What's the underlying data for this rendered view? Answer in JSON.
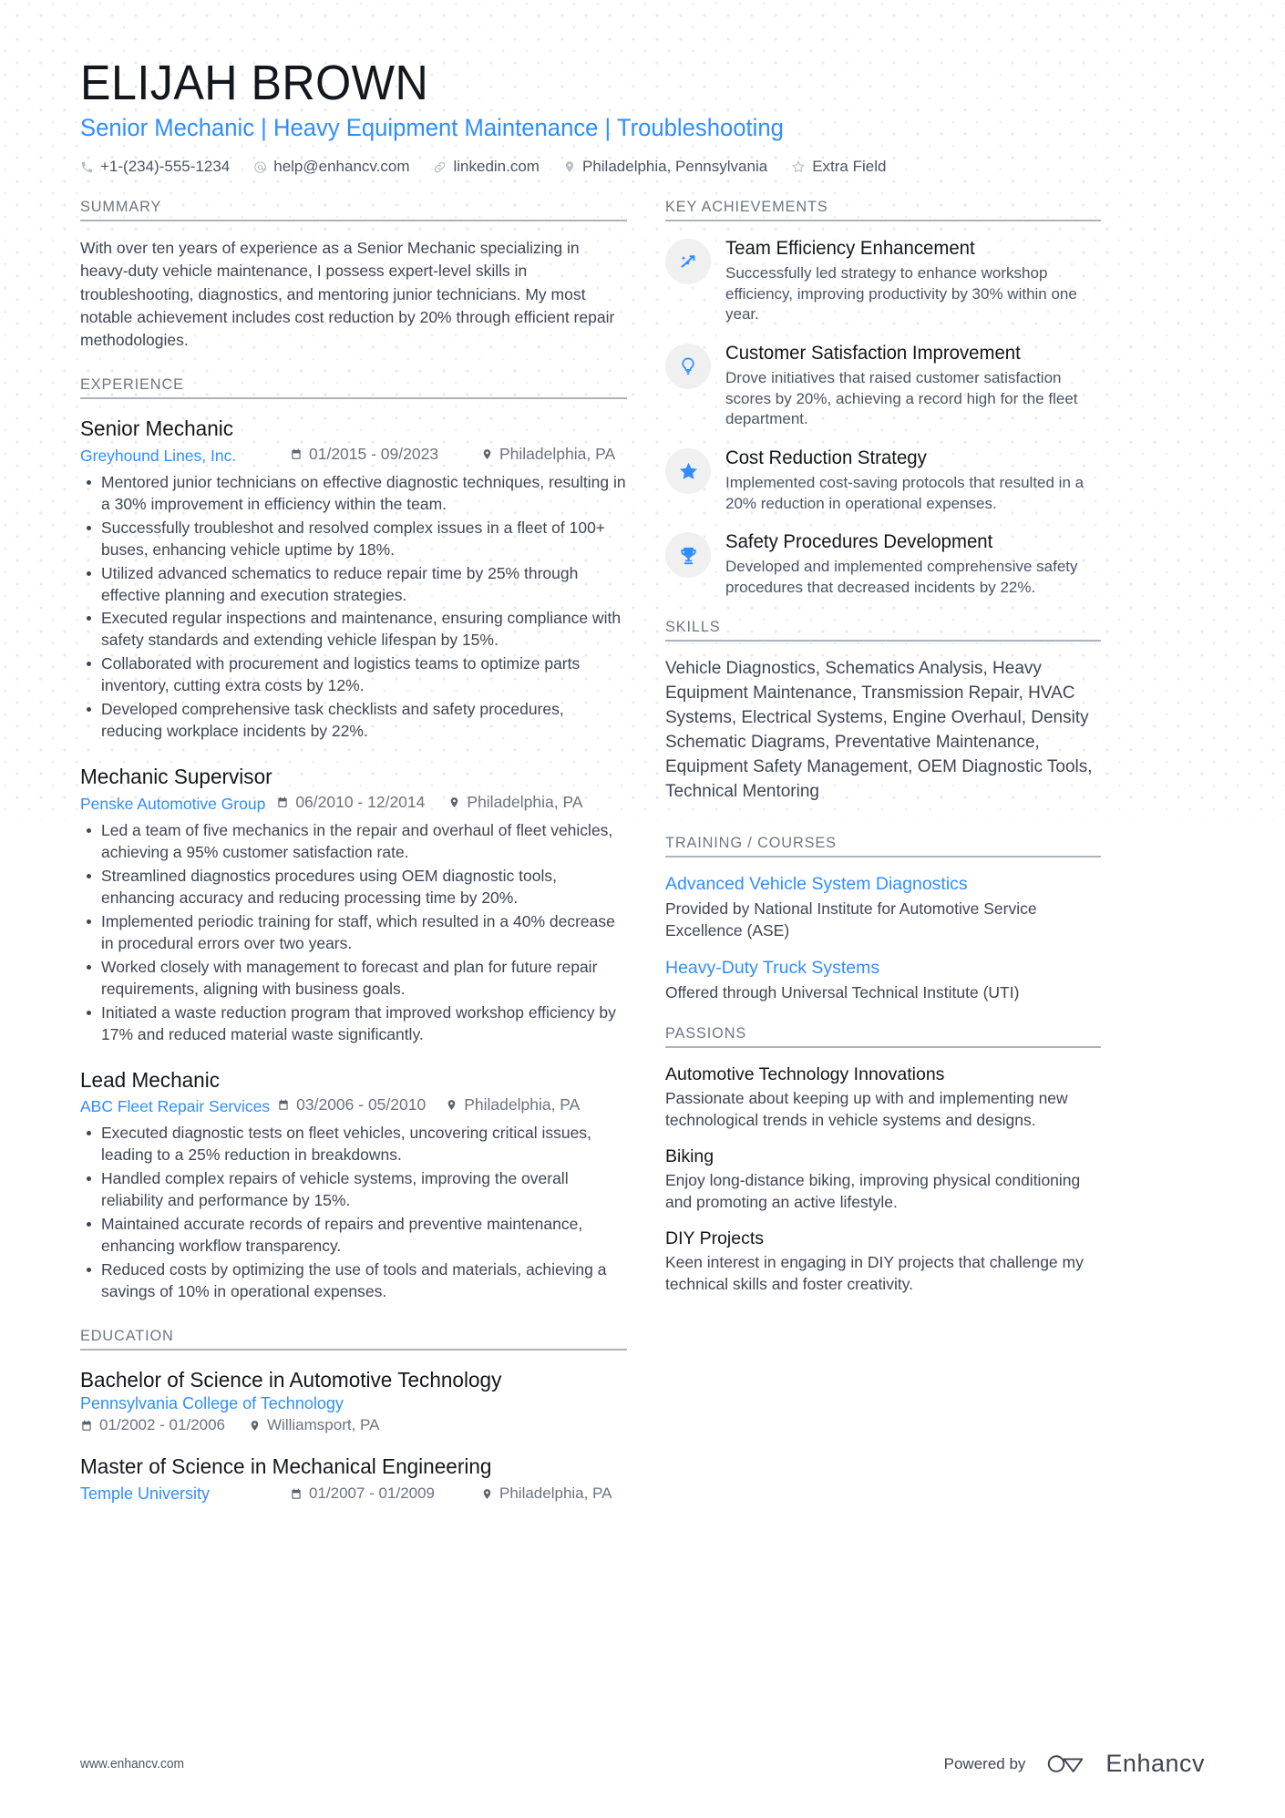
{
  "header": {
    "name": "ELIJAH BROWN",
    "headline": "Senior Mechanic | Heavy Equipment Maintenance | Troubleshooting",
    "accent_color": "#2f8eff",
    "contacts": [
      {
        "icon": "phone-icon",
        "text": "+1-(234)-555-1234"
      },
      {
        "icon": "email-icon",
        "text": "help@enhancv.com"
      },
      {
        "icon": "link-icon",
        "text": "linkedin.com"
      },
      {
        "icon": "location-pin-icon",
        "text": "Philadelphia, Pennsylvania"
      },
      {
        "icon": "star-icon",
        "text": "Extra Field"
      }
    ]
  },
  "summary": {
    "title": "SUMMARY",
    "text": "With over ten years of experience as a Senior Mechanic specializing in heavy-duty vehicle maintenance, I possess expert-level skills in troubleshooting, diagnostics, and mentoring junior technicians. My most notable achievement includes cost reduction by 20% through efficient repair methodologies."
  },
  "experience": {
    "title": "EXPERIENCE",
    "jobs": [
      {
        "role": "Senior Mechanic",
        "company": "Greyhound Lines, Inc.",
        "dates": "01/2015 - 09/2023",
        "location": "Philadelphia, PA",
        "bullets": [
          "Mentored junior technicians on effective diagnostic techniques, resulting in a 30% improvement in efficiency within the team.",
          "Successfully troubleshot and resolved complex issues in a fleet of 100+ buses, enhancing vehicle uptime by 18%.",
          "Utilized advanced schematics to reduce repair time by 25% through effective planning and execution strategies.",
          "Executed regular inspections and maintenance, ensuring compliance with safety standards and extending vehicle lifespan by 15%.",
          "Collaborated with procurement and logistics teams to optimize parts inventory, cutting extra costs by 12%.",
          "Developed comprehensive task checklists and safety procedures, reducing workplace incidents by 22%."
        ]
      },
      {
        "role": "Mechanic Supervisor",
        "company": "Penske Automotive Group",
        "dates": "06/2010 - 12/2014",
        "location": "Philadelphia, PA",
        "bullets": [
          "Led a team of five mechanics in the repair and overhaul of fleet vehicles, achieving a 95% customer satisfaction rate.",
          "Streamlined diagnostics procedures using OEM diagnostic tools, enhancing accuracy and reducing processing time by 20%.",
          "Implemented periodic training for staff, which resulted in a 40% decrease in procedural errors over two years.",
          "Worked closely with management to forecast and plan for future repair requirements, aligning with business goals.",
          "Initiated a waste reduction program that improved workshop efficiency by 17% and reduced material waste significantly."
        ]
      },
      {
        "role": "Lead Mechanic",
        "company": "ABC Fleet Repair Services",
        "dates": "03/2006 - 05/2010",
        "location": "Philadelphia, PA",
        "bullets": [
          "Executed diagnostic tests on fleet vehicles, uncovering critical issues, leading to a 25% reduction in breakdowns.",
          "Handled complex repairs of vehicle systems, improving the overall reliability and performance by 15%.",
          "Maintained accurate records of repairs and preventive maintenance, enhancing workflow transparency.",
          "Reduced costs by optimizing the use of tools and materials, achieving a savings of 10% in operational expenses."
        ]
      }
    ]
  },
  "education": {
    "title": "EDUCATION",
    "items": [
      {
        "degree": "Bachelor of Science in Automotive Technology",
        "school": "Pennsylvania College of Technology",
        "dates": "01/2002 - 01/2006",
        "location": "Williamsport, PA",
        "inline": false
      },
      {
        "degree": "Master of Science in Mechanical Engineering",
        "school": "Temple University",
        "dates": "01/2007 - 01/2009",
        "location": "Philadelphia, PA",
        "inline": true
      }
    ]
  },
  "achievements": {
    "title": "KEY ACHIEVEMENTS",
    "items": [
      {
        "icon": "magic-wand-icon",
        "heading": "Team Efficiency Enhancement",
        "text": "Successfully led strategy to enhance workshop efficiency, improving productivity by 30% within one year."
      },
      {
        "icon": "lightbulb-icon",
        "heading": "Customer Satisfaction Improvement",
        "text": "Drove initiatives that raised customer satisfaction scores by 20%, achieving a record high for the fleet department."
      },
      {
        "icon": "star-icon",
        "heading": "Cost Reduction Strategy",
        "text": "Implemented cost-saving protocols that resulted in a 20% reduction in operational expenses."
      },
      {
        "icon": "trophy-icon",
        "heading": "Safety Procedures Development",
        "text": "Developed and implemented comprehensive safety procedures that decreased incidents by 22%."
      }
    ]
  },
  "skills": {
    "title": "SKILLS",
    "text": "Vehicle Diagnostics, Schematics Analysis, Heavy Equipment Maintenance, Transmission Repair, HVAC Systems, Electrical Systems, Engine Overhaul, Density Schematic Diagrams, Preventative Maintenance, Equipment Safety Management, OEM Diagnostic Tools, Technical Mentoring"
  },
  "training": {
    "title": "TRAINING / COURSES",
    "items": [
      {
        "name": "Advanced Vehicle System Diagnostics",
        "desc": "Provided by National Institute for Automotive Service Excellence (ASE)"
      },
      {
        "name": "Heavy-Duty Truck Systems",
        "desc": "Offered through Universal Technical Institute (UTI)"
      }
    ]
  },
  "passions": {
    "title": "PASSIONS",
    "items": [
      {
        "name": "Automotive Technology Innovations",
        "desc": "Passionate about keeping up with and implementing new technological trends in vehicle systems and designs."
      },
      {
        "name": "Biking",
        "desc": "Enjoy long-distance biking, improving physical conditioning and promoting an active lifestyle."
      },
      {
        "name": "DIY Projects",
        "desc": "Keen interest in engaging in DIY projects that challenge my technical skills and foster creativity."
      }
    ]
  },
  "footer": {
    "website": "www.enhancv.com",
    "powered_by": "Powered by",
    "brand": "Enhancv"
  }
}
